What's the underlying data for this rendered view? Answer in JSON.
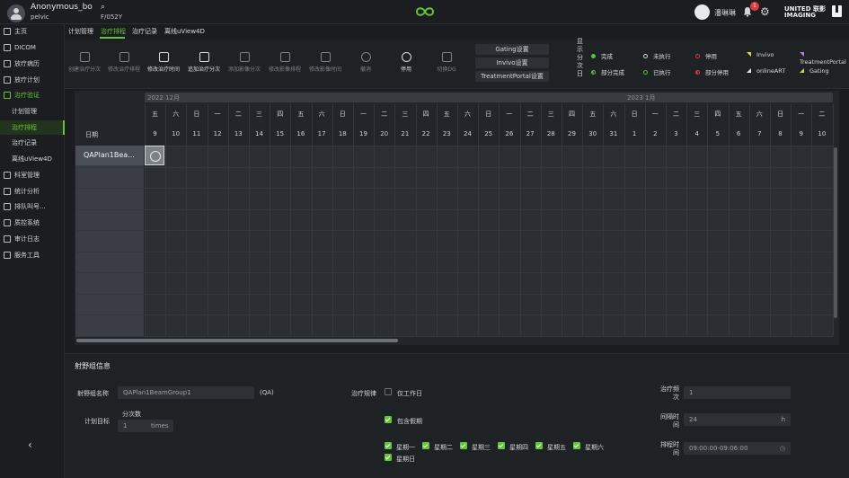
{
  "header": {
    "user_name": "Anonymous_bo",
    "user_sub": "pelvic",
    "search_icon": "search-icon",
    "patient_id": "F/052Y",
    "login_user": "潘琳琳",
    "notif_count": "1",
    "brand": "UNITED 联影\nIMAGING"
  },
  "sidebar": {
    "items": [
      {
        "label": "主页"
      },
      {
        "label": "DICOM"
      },
      {
        "label": "放疗病历"
      },
      {
        "label": "放疗计划"
      },
      {
        "label": "治疗验证"
      },
      {
        "label": "计划管理"
      },
      {
        "label": "治疗排程"
      },
      {
        "label": "治疗记录"
      },
      {
        "label": "离线uView4D"
      },
      {
        "label": "科室管理"
      },
      {
        "label": "统计分析"
      },
      {
        "label": "排队叫号..."
      },
      {
        "label": "质控系统"
      },
      {
        "label": "审计日志"
      },
      {
        "label": "服务工具"
      }
    ]
  },
  "tabs": [
    "计划管理",
    "治疗排程",
    "治疗记录",
    "离线uView4D"
  ],
  "toolbar": {
    "tools": [
      "创建治疗分次",
      "修改治疗排程",
      "修改治疗时间",
      "追加治疗分次",
      "添加影像分次",
      "修改影像排程",
      "修改影像时间",
      "撤消",
      "停用",
      "切换DG"
    ],
    "settings": [
      "Gating设置",
      "Invivo设置",
      "TreatmentPortal设置"
    ],
    "legend_title": "显示分次日",
    "legend": [
      {
        "label": "完成",
        "color": "#4fc13a",
        "kind": "dot"
      },
      {
        "label": "未执行",
        "color": "#cfd3d8",
        "kind": "ring"
      },
      {
        "label": "停用",
        "color": "#e0393e",
        "kind": "ring"
      },
      {
        "label": "Invivo",
        "color": "#e6d23a",
        "kind": "tri"
      },
      {
        "label": "TreatmentPortal",
        "color": "#b77ae6",
        "kind": "tri"
      },
      {
        "label": "部分完成",
        "color": "#4fc13a",
        "kind": "half"
      },
      {
        "label": "已执行",
        "color": "#4fc13a",
        "kind": "ring"
      },
      {
        "label": "部分停用",
        "color": "#e0393e",
        "kind": "half"
      },
      {
        "label": "onlineART",
        "color": "#e4e6e9",
        "kind": "tri"
      },
      {
        "label": "Gating",
        "color": "#c5e03a",
        "kind": "tri"
      }
    ]
  },
  "calendar": {
    "months": [
      "2022 12月",
      "2023 1月"
    ],
    "date_label": "日期",
    "weekdays": [
      "五",
      "六",
      "日",
      "一",
      "二",
      "三",
      "四",
      "五",
      "六",
      "日",
      "一",
      "二",
      "三",
      "四",
      "五",
      "六",
      "日",
      "一",
      "二",
      "三",
      "四",
      "五",
      "六",
      "日",
      "一",
      "二",
      "三",
      "四",
      "五",
      "六",
      "日",
      "一",
      "二"
    ],
    "days": [
      "9",
      "10",
      "11",
      "12",
      "13",
      "14",
      "15",
      "16",
      "17",
      "18",
      "19",
      "20",
      "21",
      "22",
      "23",
      "24",
      "25",
      "26",
      "27",
      "28",
      "29",
      "30",
      "31",
      "1",
      "2",
      "3",
      "4",
      "5",
      "6",
      "7",
      "8",
      "9",
      "10"
    ],
    "rows": [
      "QAPlan1Bea..."
    ]
  },
  "info": {
    "title": "射野组信息",
    "group_name_label": "射野组名称",
    "group_name_value": "QAPlan1BeamGroup1",
    "group_suffix": "(QA)",
    "plan_target_label": "计划目标",
    "fractions_label": "分次数",
    "fractions_value": "1",
    "fractions_unit": "times",
    "rule_label": "治疗规律",
    "workday_label": "仅工作日",
    "holiday_label": "包含假期",
    "weekdays": [
      "星期一",
      "星期二",
      "星期三",
      "星期四",
      "星期五",
      "星期六",
      "星期日"
    ],
    "freq_label": "治疗频次",
    "freq_value": "1",
    "interval_label": "间隔时间",
    "interval_value": "24",
    "interval_unit": "h",
    "time_label": "排程时间",
    "time_value": "09:00:00-09:06:00"
  }
}
